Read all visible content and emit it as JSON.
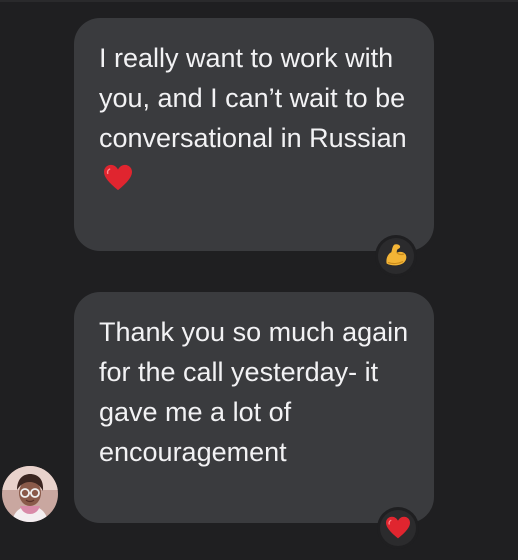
{
  "messages": [
    {
      "text": "I really want to work with you, and I can’t wait to be conversational in Russian",
      "inline_emoji": "heart-icon",
      "reaction": "flexed-biceps-icon"
    },
    {
      "text": "Thank you so much again for the call yesterday- it gave me a lot of encouragement",
      "reaction": "heart-icon"
    }
  ],
  "colors": {
    "background": "#1f1f21",
    "bubble": "#3a3b3e",
    "text": "#f2f2f4",
    "heart": "#e0252f"
  }
}
